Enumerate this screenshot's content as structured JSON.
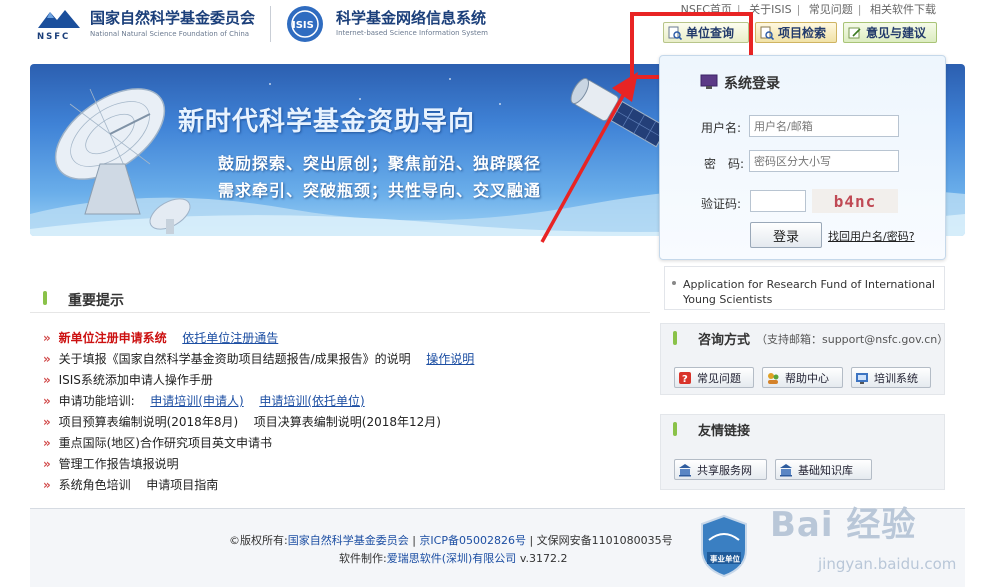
{
  "header": {
    "nsfc_name_cn": "国家自然科学基金委员会",
    "nsfc_name_en": "National Natural Science Foundation of China",
    "nsfc_logo_text": "NSFC",
    "isis_logo_text": "ISIS",
    "isis_name_cn": "科学基金网络信息系统",
    "isis_name_en": "Internet-based Science Information System",
    "top_links": [
      "NSFC首页",
      "关于ISIS",
      "常见问题",
      "相关软件下载"
    ],
    "query_buttons": {
      "unit": "单位查询",
      "project": "项目检索",
      "feedback": "意见与建议"
    }
  },
  "banner": {
    "title": "新时代科学基金资助导向",
    "line1": "鼓励探索、突出原创；聚焦前沿、独辟蹊径",
    "line2": "需求牵引、突破瓶颈；共性导向、交叉融通"
  },
  "login": {
    "title": "系统登录",
    "username_label": "用户名:",
    "username_placeholder": "用户名/邮箱",
    "password_label": "密　码:",
    "password_placeholder": "密码区分大小写",
    "captcha_label": "验证码:",
    "captcha_value": "",
    "captcha_image_text": "b4nc",
    "login_button": "登录",
    "forgot_link": "找回用户名/密码?"
  },
  "young_scientists": "Application for Research Fund of International Young Scientists",
  "consult": {
    "title": "咨询方式",
    "subtitle": "（支持邮箱：support@nsfc.gov.cn）",
    "buttons": [
      "常见问题",
      "帮助中心",
      "培训系统"
    ]
  },
  "friend_links": {
    "title": "友情链接",
    "buttons": [
      "共享服务网",
      "基础知识库"
    ]
  },
  "notices": {
    "title": "重要提示",
    "items": [
      {
        "text": "新单位注册申请系统",
        "link": "依托单位注册通告"
      },
      {
        "text": "关于填报《国家自然科学基金资助项目结题报告/成果报告》的说明",
        "link": "操作说明"
      },
      {
        "text": "ISIS系统添加申请人操作手册"
      },
      {
        "text": "申请功能培训:",
        "link": "申请培训(申请人)",
        "link2": "申请培训(依托单位)"
      },
      {
        "text": "项目预算表编制说明(2018年8月)",
        "text2": "项目决算表编制说明(2018年12月)"
      },
      {
        "text": "重点国际(地区)合作研究项目英文申请书"
      },
      {
        "text": "管理工作报告填报说明"
      },
      {
        "text": "系统角色培训",
        "text2": "申请项目指南"
      }
    ]
  },
  "footer": {
    "copyright_prefix": "©版权所有:",
    "owner": "国家自然科学基金委员会",
    "icp": "京ICP备05002826号",
    "police": "文保网安备1101080035号",
    "maker_prefix": "软件制作:",
    "maker": "爱瑞思软件(深圳)有限公司",
    "version": "v.3172.2",
    "badge_text": "事业单位"
  },
  "watermark": {
    "main": "Bai 经验",
    "sub": "jingyan.baidu.com"
  },
  "colors": {
    "annotation_red": "#e82424",
    "brand_blue": "#1b3f7a",
    "link_blue": "#1d4fa3",
    "notice_red": "#cc1111",
    "accent_green": "#8ac249"
  }
}
